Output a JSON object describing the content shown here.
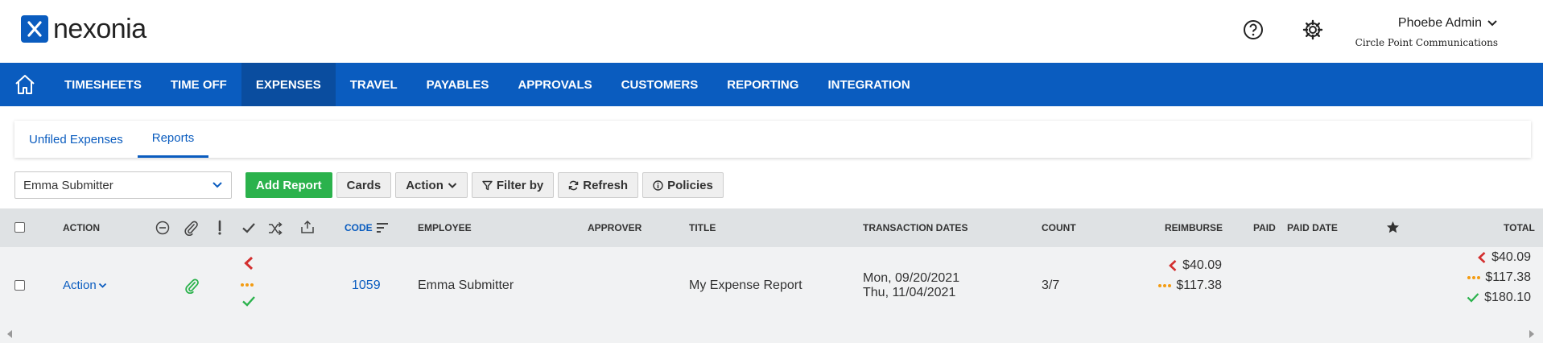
{
  "header": {
    "logo_text": "nexonia",
    "user_name": "Phoebe Admin",
    "company": "Circle Point Communications",
    "icons": [
      "help-circle-icon",
      "gear-icon",
      "chevron-down-icon"
    ]
  },
  "nav": {
    "items": [
      {
        "label": "TIMESHEETS"
      },
      {
        "label": "TIME OFF"
      },
      {
        "label": "EXPENSES",
        "active": true
      },
      {
        "label": "TRAVEL"
      },
      {
        "label": "PAYABLES"
      },
      {
        "label": "APPROVALS"
      },
      {
        "label": "CUSTOMERS"
      },
      {
        "label": "REPORTING"
      },
      {
        "label": "INTEGRATION"
      }
    ]
  },
  "subtabs": [
    {
      "label": "Unfiled Expenses"
    },
    {
      "label": "Reports",
      "active": true
    }
  ],
  "toolbar": {
    "employee_select": "Emma Submitter",
    "add_report": "Add Report",
    "cards": "Cards",
    "action": "Action",
    "filter": "Filter by",
    "refresh": "Refresh",
    "policies": "Policies"
  },
  "table": {
    "headers": {
      "action": "ACTION",
      "code": "CODE",
      "employee": "EMPLOYEE",
      "approver": "APPROVER",
      "title": "TITLE",
      "transaction_dates": "TRANSACTION DATES",
      "count": "COUNT",
      "reimburse": "REIMBURSE",
      "paid": "PAID",
      "paid_date": "PAID DATE",
      "total": "TOTAL"
    },
    "rows": [
      {
        "action": "Action",
        "code": "1059",
        "employee": "Emma Submitter",
        "approver": "",
        "title": "My Expense Report",
        "date_start": "Mon, 09/20/2021",
        "date_end": "Thu, 11/04/2021",
        "count": "3/7",
        "reimburse": [
          "$40.09",
          "$117.38"
        ],
        "total": [
          "$40.09",
          "$117.38",
          "$180.10"
        ]
      }
    ]
  },
  "colors": {
    "brand": "#0a5cbf",
    "nav_active": "#0a4d9f",
    "primary_button": "#2bb24c",
    "returned": "#d32f2f",
    "pending": "#f39c12",
    "approved": "#2bb24c"
  }
}
